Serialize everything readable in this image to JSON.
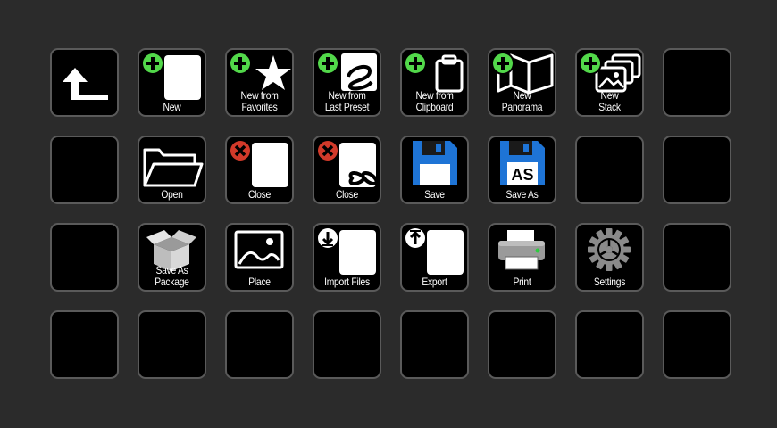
{
  "colors": {
    "background": "#2b2b2b",
    "key_fill": "#000000",
    "key_border": "#5a5a5a",
    "add_badge": "#52d84a",
    "close_badge": "#d23a2a",
    "floppy_blue": "#1e74d6",
    "printer_led": "#2ecc40"
  },
  "keys": {
    "back": {
      "label": "",
      "icon": "back-arrow-icon"
    },
    "new": {
      "label": "New",
      "icon": "new-document-icon"
    },
    "new_from_favorites": {
      "line1": "New from",
      "line2": "Favorites",
      "icon": "star-icon"
    },
    "new_from_last_preset": {
      "line1": "New from",
      "line2": "Last Preset",
      "icon": "preset-icon"
    },
    "new_from_clipboard": {
      "line1": "New from",
      "line2": "Clipboard",
      "icon": "clipboard-icon"
    },
    "new_panorama": {
      "line1": "New",
      "line2": "Panorama",
      "icon": "panorama-map-icon"
    },
    "new_stack": {
      "line1": "New",
      "line2": "Stack",
      "icon": "image-stack-icon"
    },
    "open": {
      "label": "Open",
      "icon": "folder-icon"
    },
    "close": {
      "label": "Close",
      "icon": "close-document-icon"
    },
    "close_all": {
      "label": "Close",
      "icon": "close-all-infinity-icon"
    },
    "save": {
      "label": "Save",
      "icon": "floppy-disk-icon"
    },
    "save_as": {
      "label": "Save As",
      "icon": "floppy-disk-as-icon",
      "badge": "AS"
    },
    "save_as_package": {
      "line1": "Save As",
      "line2": "Package",
      "icon": "package-box-icon"
    },
    "place": {
      "label": "Place",
      "icon": "image-icon"
    },
    "import_files": {
      "label": "Import Files",
      "icon": "import-icon"
    },
    "export": {
      "label": "Export",
      "icon": "export-icon"
    },
    "print": {
      "label": "Print",
      "icon": "printer-icon"
    },
    "settings": {
      "label": "Settings",
      "icon": "gear-icon"
    }
  }
}
